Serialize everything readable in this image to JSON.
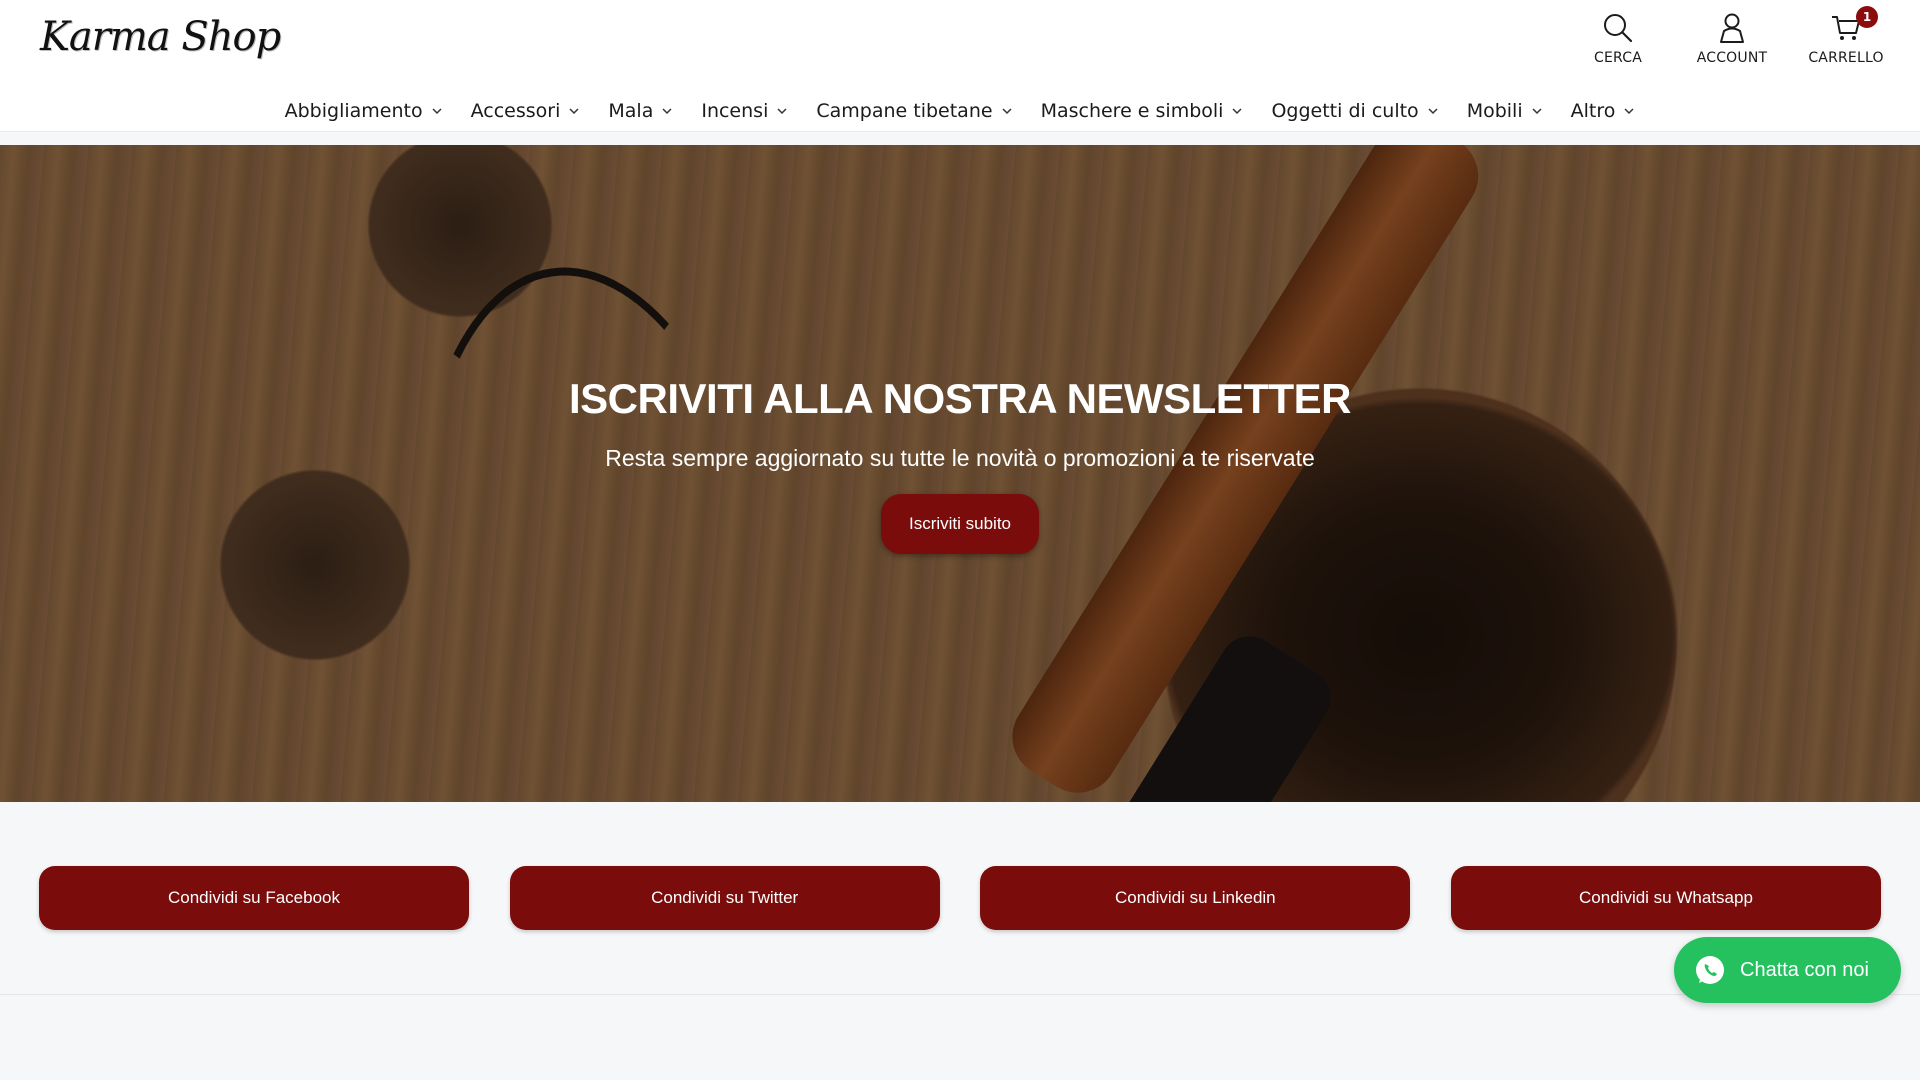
{
  "brand": {
    "logo_text": "Karma Shop"
  },
  "header": {
    "search_label": "CERCA",
    "account_label": "ACCOUNT",
    "cart_label": "CARRELLO",
    "cart_count": "1"
  },
  "nav": {
    "items": [
      {
        "label": "Abbigliamento"
      },
      {
        "label": "Accessori"
      },
      {
        "label": "Mala"
      },
      {
        "label": "Incensi"
      },
      {
        "label": "Campane tibetane"
      },
      {
        "label": "Maschere e simboli"
      },
      {
        "label": "Oggetti di culto"
      },
      {
        "label": "Mobili"
      },
      {
        "label": "Altro"
      }
    ]
  },
  "hero": {
    "title": "ISCRIVITI ALLA NOSTRA NEWSLETTER",
    "subtitle": "Resta sempre aggiornato su tutte le novità o promozioni a te riservate",
    "button_label": "Iscriviti subito"
  },
  "share": {
    "facebook": "Condividi su Facebook",
    "twitter": "Condividi su Twitter",
    "linkedin": "Condividi su Linkedin",
    "whatsapp": "Condividi su Whatsapp"
  },
  "chat": {
    "label": "Chatta con noi"
  },
  "colors": {
    "accent": "#7a0c0c",
    "chat": "#25c15f"
  }
}
